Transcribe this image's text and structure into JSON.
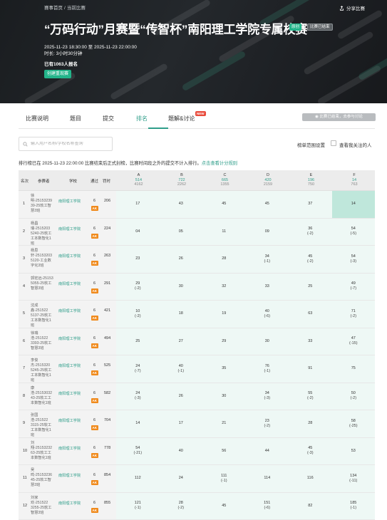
{
  "breadcrumb": {
    "home": "赛事首页",
    "current": "当前比赛"
  },
  "share_label": "分享比赛",
  "contest": {
    "title": "“万码行动”月赛暨“传智杯”南阳理工学院专属校赛",
    "open_tag": "原创",
    "status_tag": "比赛已结束",
    "time": "2025-11-23 18:30:00 至 2025-11-23 22:00:00",
    "duration": "时长: 3小时30分钟",
    "signup_count": "已有1063人报名",
    "signup_button": "创建重现赛"
  },
  "tabs": [
    {
      "label": "比赛说明",
      "active": false
    },
    {
      "label": "题目",
      "active": false
    },
    {
      "label": "提交",
      "active": false
    },
    {
      "label": "排名",
      "active": true
    },
    {
      "label": "题解&讨论",
      "active": false
    }
  ],
  "new_badge": "NEW",
  "ended_button": "比赛已结束，去参与讨论",
  "search": {
    "placeholder": "输入用户名称/学校名称查询"
  },
  "filters": {
    "range_label": "榜单范围设置",
    "follow_label": "查看我关注的人"
  },
  "notice": {
    "text": "排行榜已在 2025-11-23 22:00:00 比赛结束后正式封榜，比赛时间段之外的提交不计入排行。",
    "link": "点击查看计分规则"
  },
  "table": {
    "headers": {
      "rank": "名次",
      "participant": "参赛者",
      "school": "学校",
      "solved": "通过",
      "penalty": "罚时"
    },
    "problems": [
      {
        "label": "A",
        "ac": "514",
        "sub": "4162"
      },
      {
        "label": "B",
        "ac": "722",
        "sub": "2262"
      },
      {
        "label": "C",
        "ac": "665",
        "sub": "1355"
      },
      {
        "label": "D",
        "ac": "420",
        "sub": "2159"
      },
      {
        "label": "E",
        "ac": "196",
        "sub": "750"
      },
      {
        "label": "F",
        "ac": "14",
        "sub": "763"
      }
    ],
    "rows": [
      {
        "rank": "1",
        "name": "徐明-25153239 39-25软工智慧3班",
        "school": "南阳理工学院",
        "solved": "6",
        "penalty": "206",
        "badge": "AK",
        "cells": [
          {
            "t": "17",
            "p": ""
          },
          {
            "t": "43",
            "p": ""
          },
          {
            "t": "45",
            "p": ""
          },
          {
            "t": "45",
            "p": ""
          },
          {
            "t": "37",
            "p": ""
          },
          {
            "t": "14",
            "p": "",
            "hl": true
          }
        ]
      },
      {
        "rank": "2",
        "name": "杨昌瑞-2515203 5240-25软工工本数智化1班",
        "school": "南阳理工学院",
        "solved": "6",
        "penalty": "224",
        "badge": "AK",
        "cells": [
          {
            "t": "04",
            "p": ""
          },
          {
            "t": "05",
            "p": ""
          },
          {
            "t": "11",
            "p": ""
          },
          {
            "t": "09",
            "p": ""
          },
          {
            "t": "36",
            "p": "(-2)"
          },
          {
            "t": "54",
            "p": "(-5)"
          }
        ]
      },
      {
        "rank": "3",
        "name": "杨思轩-25153203 5120-工业数字化3班",
        "school": "南阳理工学院",
        "solved": "6",
        "penalty": "263",
        "badge": "AK",
        "cells": [
          {
            "t": "23",
            "p": ""
          },
          {
            "t": "26",
            "p": ""
          },
          {
            "t": "28",
            "p": ""
          },
          {
            "t": "34",
            "p": "(-1)"
          },
          {
            "t": "45",
            "p": "(-2)"
          },
          {
            "t": "54",
            "p": "(-3)"
          }
        ]
      },
      {
        "rank": "4",
        "name": "郭宏远-25153 5055-25软工智慧3班",
        "school": "南阳理工学院",
        "solved": "6",
        "penalty": "291",
        "badge": "AK",
        "cells": [
          {
            "t": "29",
            "p": "(-2)"
          },
          {
            "t": "30",
            "p": ""
          },
          {
            "t": "32",
            "p": ""
          },
          {
            "t": "33",
            "p": ""
          },
          {
            "t": "25",
            "p": ""
          },
          {
            "t": "49",
            "p": "(-7)"
          }
        ]
      },
      {
        "rank": "5",
        "name": "沈成鑫-251522 5137-25软工工本数智化1班",
        "school": "南阳理工学院",
        "solved": "6",
        "penalty": "421",
        "badge": "AK",
        "cells": [
          {
            "t": "10",
            "p": "(-2)"
          },
          {
            "t": "18",
            "p": ""
          },
          {
            "t": "19",
            "p": ""
          },
          {
            "t": "40",
            "p": "(-6)"
          },
          {
            "t": "63",
            "p": ""
          },
          {
            "t": "71",
            "p": "(-2)"
          }
        ]
      },
      {
        "rank": "6",
        "name": "徐瑞浩-251522 3393-25软工智慧3班",
        "school": "南阳理工学院",
        "solved": "6",
        "penalty": "494",
        "badge": "AK",
        "cells": [
          {
            "t": "25",
            "p": ""
          },
          {
            "t": "27",
            "p": ""
          },
          {
            "t": "29",
            "p": ""
          },
          {
            "t": "30",
            "p": ""
          },
          {
            "t": "33",
            "p": ""
          },
          {
            "t": "47",
            "p": "(-15)"
          }
        ]
      },
      {
        "rank": "7",
        "name": "李俊杰-2515320 5245-25软工工本数智化1班",
        "school": "南阳理工学院",
        "solved": "6",
        "penalty": "525",
        "badge": "AK",
        "cells": [
          {
            "t": "24",
            "p": "(-7)"
          },
          {
            "t": "40",
            "p": "(-1)"
          },
          {
            "t": "35",
            "p": ""
          },
          {
            "t": "76",
            "p": "(-1)"
          },
          {
            "t": "91",
            "p": ""
          },
          {
            "t": "75",
            "p": ""
          }
        ]
      },
      {
        "rank": "8",
        "name": "康浩-25153032 43-25软工工本数智化1班",
        "school": "南阳理工学院",
        "solved": "6",
        "penalty": "582",
        "badge": "AK",
        "cells": [
          {
            "t": "24",
            "p": "(-3)"
          },
          {
            "t": "26",
            "p": ""
          },
          {
            "t": "30",
            "p": ""
          },
          {
            "t": "34",
            "p": "(-3)"
          },
          {
            "t": "55",
            "p": "(-2)"
          },
          {
            "t": "50",
            "p": "(-2)"
          }
        ]
      },
      {
        "rank": "9",
        "name": "张国浩-251522 3115-25软工工本数智化1班",
        "school": "南阳理工学院",
        "solved": "6",
        "penalty": "704",
        "badge": "AK",
        "cells": [
          {
            "t": "14",
            "p": ""
          },
          {
            "t": "17",
            "p": ""
          },
          {
            "t": "21",
            "p": ""
          },
          {
            "t": "23",
            "p": "(-2)"
          },
          {
            "t": "28",
            "p": ""
          },
          {
            "t": "58",
            "p": "(-25)"
          }
        ]
      },
      {
        "rank": "10",
        "name": "刘翔-25153232 63-25软工工本数智化1班",
        "school": "南阳理工学院",
        "solved": "6",
        "penalty": "778",
        "badge": "AK",
        "cells": [
          {
            "t": "54",
            "p": "(-21)"
          },
          {
            "t": "40",
            "p": ""
          },
          {
            "t": "56",
            "p": ""
          },
          {
            "t": "44",
            "p": ""
          },
          {
            "t": "45",
            "p": "(-3)"
          },
          {
            "t": "53",
            "p": ""
          }
        ]
      },
      {
        "rank": "11",
        "name": "吴鸣-25153236 45-25软工智慧3班",
        "school": "南阳理工学院",
        "solved": "6",
        "penalty": "854",
        "badge": "AK",
        "cells": [
          {
            "t": "112",
            "p": ""
          },
          {
            "t": "24",
            "p": ""
          },
          {
            "t": "111",
            "p": "(-1)"
          },
          {
            "t": "114",
            "p": ""
          },
          {
            "t": "116",
            "p": ""
          },
          {
            "t": "134",
            "p": "(-11)"
          }
        ]
      },
      {
        "rank": "12",
        "name": "刘家欢-251522 3255-25软工智慧3班",
        "school": "南阳理工学院",
        "solved": "6",
        "penalty": "855",
        "badge": "AK",
        "cells": [
          {
            "t": "121",
            "p": "(-1)"
          },
          {
            "t": "28",
            "p": "(-2)"
          },
          {
            "t": "45",
            "p": ""
          },
          {
            "t": "151",
            "p": "(-6)"
          },
          {
            "t": "82",
            "p": ""
          },
          {
            "t": "185",
            "p": "(-1)"
          }
        ]
      }
    ]
  }
}
